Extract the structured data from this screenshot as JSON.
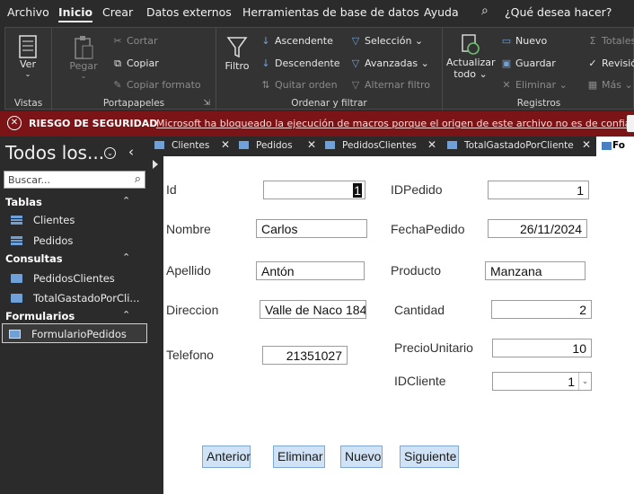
{
  "menu": {
    "items": [
      "Archivo",
      "Inicio",
      "Crear",
      "Datos externos",
      "Herramientas de base de datos",
      "Ayuda"
    ],
    "active": "Inicio",
    "search_placeholder": "¿Qué desea hacer?",
    "search_icon": "search-icon"
  },
  "ribbon": {
    "groups": {
      "vistas": {
        "label": "Vistas",
        "ver": "Ver"
      },
      "portapapeles": {
        "label": "Portapapeles",
        "pegar": "Pegar",
        "cortar": "Cortar",
        "copiar": "Copiar",
        "copiar_formato": "Copiar formato"
      },
      "ordenar": {
        "label": "Ordenar y filtrar",
        "filtro": "Filtro",
        "ascendente": "Ascendente",
        "descendente": "Descendente",
        "quitar_orden": "Quitar orden",
        "seleccion": "Selección",
        "avanzadas": "Avanzadas",
        "alternar_filtro": "Alternar filtro"
      },
      "registros": {
        "label": "Registros",
        "actualizar": "Actualizar",
        "todo": "todo",
        "nuevo": "Nuevo",
        "guardar": "Guardar",
        "eliminar": "Eliminar",
        "totales": "Totales",
        "revision": "Revisión",
        "mas": "Más"
      }
    }
  },
  "security_bar": {
    "title": "RIESGO DE SEGURIDAD",
    "message": "Microsoft ha bloqueado la ejecución de macros porque el origen de este archivo no es de confianza.",
    "color": "#7a1416"
  },
  "nav_pane": {
    "title": "Todos los...",
    "search_placeholder": "Buscar...",
    "sections": {
      "tablas": {
        "label": "Tablas",
        "items": [
          "Clientes",
          "Pedidos"
        ]
      },
      "consultas": {
        "label": "Consultas",
        "items": [
          "PedidosClientes",
          "TotalGastadoPorCli..."
        ]
      },
      "formularios": {
        "label": "Formularios",
        "items": [
          "FormularioPedidos"
        ]
      }
    },
    "selected": "FormularioPedidos"
  },
  "tabs": {
    "items": [
      "Clientes",
      "Pedidos",
      "PedidosClientes",
      "TotalGastadoPorCliente"
    ],
    "active_partial": "Fo"
  },
  "form": {
    "labels": {
      "id": "Id",
      "nombre": "Nombre",
      "apellido": "Apellido",
      "direccion": "Direccion",
      "telefono": "Telefono",
      "idpedido": "IDPedido",
      "fechapedido": "FechaPedido",
      "producto": "Producto",
      "cantidad": "Cantidad",
      "preciounitario": "PrecioUnitario",
      "idcliente": "IDCliente"
    },
    "values": {
      "id": "1",
      "nombre": "Carlos",
      "apellido": "Antón",
      "direccion": "Valle de Naco 184",
      "telefono": "21351027",
      "idpedido": "1",
      "fechapedido": "26/11/2024",
      "producto": "Manzana",
      "cantidad": "2",
      "preciounitario": "10",
      "idcliente": "1"
    },
    "buttons": {
      "anterior": "Anterior",
      "eliminar": "Eliminar",
      "nuevo": "Nuevo",
      "siguiente": "Siguiente"
    }
  },
  "colors": {
    "button_bg": "#cfe2f6",
    "button_border": "#7fa7d4",
    "chrome_bg": "#2b2b2b",
    "icon_blue": "#6fa0d8"
  }
}
